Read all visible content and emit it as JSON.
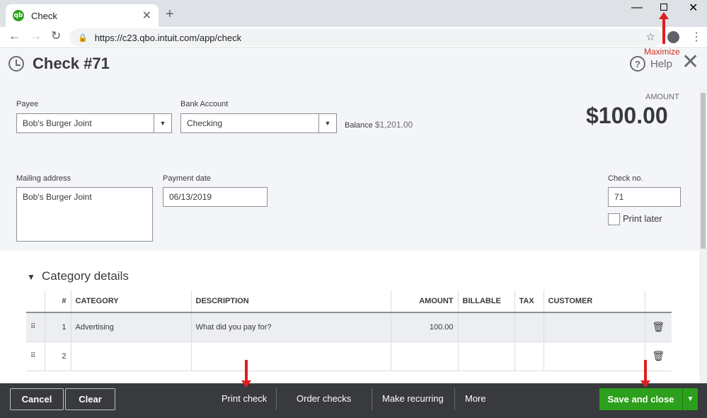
{
  "browser": {
    "tab_title": "Check",
    "favicon_text": "qb",
    "url": "https://c23.qbo.intuit.com/app/check"
  },
  "header": {
    "title": "Check #71",
    "help_label": "Help"
  },
  "annotation": {
    "maximize_note": "Maximize"
  },
  "form": {
    "payee_label": "Payee",
    "payee_value": "Bob's Burger Joint",
    "bank_account_label": "Bank Account",
    "bank_account_value": "Checking",
    "balance_label": "Balance",
    "balance_value": "$1,201.00",
    "amount_label": "AMOUNT",
    "amount_value": "$100.00",
    "mailing_address_label": "Mailing address",
    "mailing_address_value": "Bob's Burger Joint",
    "payment_date_label": "Payment date",
    "payment_date_value": "06/13/2019",
    "check_no_label": "Check no.",
    "check_no_value": "71",
    "print_later_label": "Print later"
  },
  "category_details": {
    "title": "Category details",
    "columns": [
      "#",
      "CATEGORY",
      "DESCRIPTION",
      "AMOUNT",
      "BILLABLE",
      "TAX",
      "CUSTOMER"
    ],
    "rows": [
      {
        "num": "1",
        "category": "Advertising",
        "description_placeholder": "What did you pay for?",
        "amount": "100.00"
      },
      {
        "num": "2",
        "category": "",
        "description_placeholder": "",
        "amount": ""
      }
    ]
  },
  "footer": {
    "cancel": "Cancel",
    "clear": "Clear",
    "print_check": "Print check",
    "order_checks": "Order checks",
    "make_recurring": "Make recurring",
    "more": "More",
    "save_and_close": "Save and close"
  },
  "colors": {
    "accent_green": "#2ca01c",
    "footer_bg": "#393a3d",
    "annotation_red": "#e01e1e"
  }
}
